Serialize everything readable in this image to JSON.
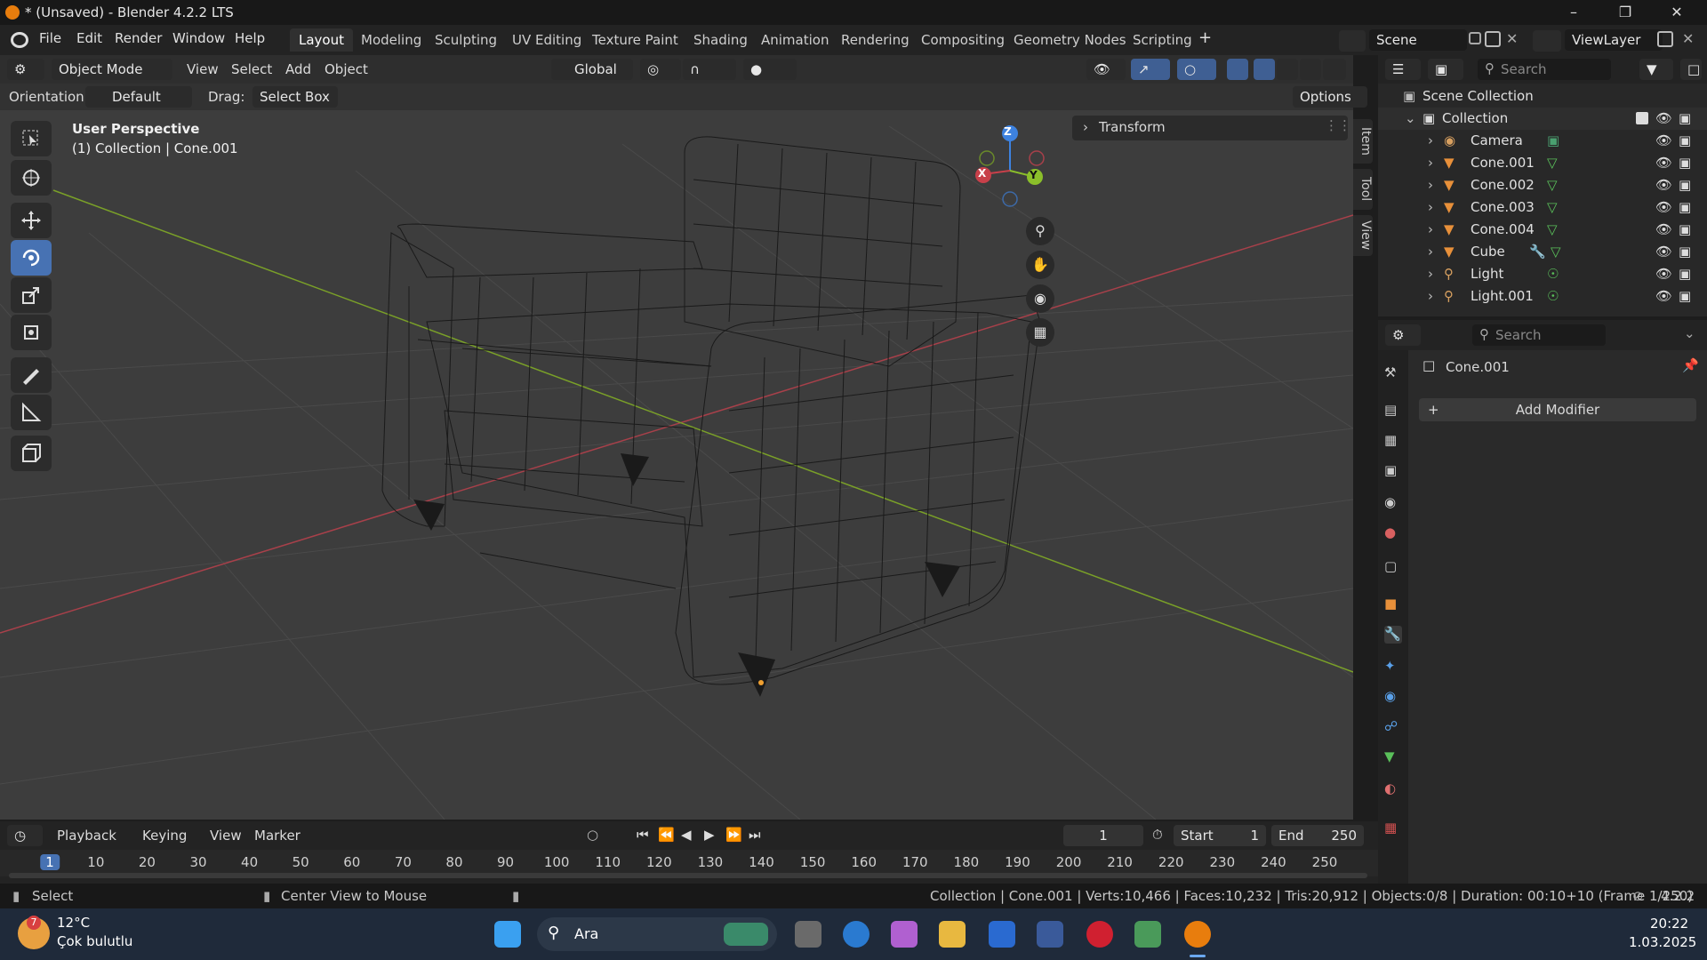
{
  "titlebar": {
    "title": "* (Unsaved) - Blender 4.2.2 LTS"
  },
  "menu": {
    "file": "File",
    "edit": "Edit",
    "render": "Render",
    "window": "Window",
    "help": "Help"
  },
  "workspaces": [
    "Layout",
    "Modeling",
    "Sculpting",
    "UV Editing",
    "Texture Paint",
    "Shading",
    "Animation",
    "Rendering",
    "Compositing",
    "Geometry Nodes",
    "Scripting"
  ],
  "scene": {
    "name": "Scene",
    "view_layer": "ViewLayer"
  },
  "viewport": {
    "mode": "Object Mode",
    "menus": [
      "View",
      "Select",
      "Add",
      "Object"
    ],
    "transform_orientation": "Global",
    "orientation_label": "Orientation:",
    "orientation_value": "Default",
    "drag_label": "Drag:",
    "drag_value": "Select Box",
    "options": "Options",
    "perspective": "User Perspective",
    "object_info": "(1) Collection | Cone.001",
    "transform_panel": "Transform",
    "side_tabs": [
      "Item",
      "Tool",
      "View"
    ],
    "axes": {
      "x": "X",
      "y": "Y",
      "z": "Z"
    }
  },
  "outliner": {
    "search_placeholder": "Search",
    "root": "Scene Collection",
    "collection": "Collection",
    "items": [
      "Camera",
      "Cone.001",
      "Cone.002",
      "Cone.003",
      "Cone.004",
      "Cube",
      "Light",
      "Light.001"
    ]
  },
  "properties": {
    "search_placeholder": "Search",
    "object_name": "Cone.001",
    "add_modifier": "Add Modifier"
  },
  "timeline": {
    "menus": [
      "Playback",
      "Keying",
      "View",
      "Marker"
    ],
    "current_frame": "1",
    "start_label": "Start",
    "start_value": "1",
    "end_label": "End",
    "end_value": "250",
    "ticks": [
      "1",
      "10",
      "20",
      "30",
      "40",
      "50",
      "60",
      "70",
      "80",
      "90",
      "100",
      "110",
      "120",
      "130",
      "140",
      "150",
      "160",
      "170",
      "180",
      "190",
      "200",
      "210",
      "220",
      "230",
      "240",
      "250"
    ]
  },
  "statusbar": {
    "select": "Select",
    "center_view": "Center View to Mouse",
    "stats": "Collection | Cone.001 | Verts:10,466 | Faces:10,232 | Tris:20,912 | Objects:0/8 | Duration: 00:10+10 (Frame 1/250)",
    "version": "4.2.2"
  },
  "taskbar": {
    "weather_temp": "12°C",
    "weather_desc": "Çok bulutlu",
    "weather_badge": "7",
    "search": "Ara",
    "time": "20:22",
    "date": "1.03.2025"
  },
  "colors": {
    "accent": "#4772b3",
    "x_axis": "#c8404a",
    "y_axis": "#8bbf2a",
    "z_axis": "#3d82e0",
    "blender_orange": "#e87d0d"
  }
}
